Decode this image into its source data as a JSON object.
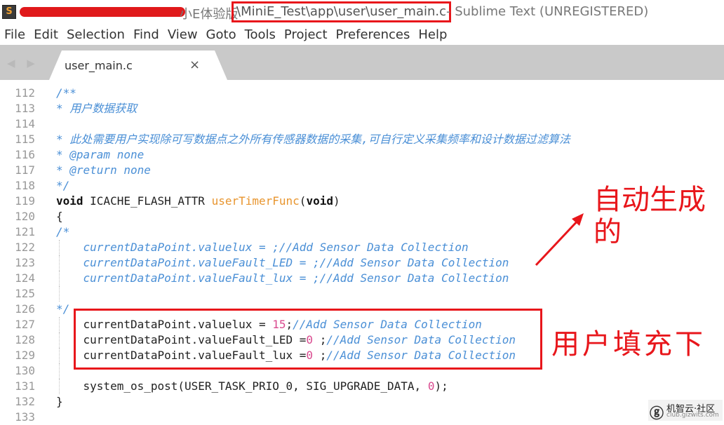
{
  "window": {
    "icon_label": "S",
    "title_path_prefix": "小E体验版",
    "title_path_highlighted": "\\MiniE_Test\\app\\user\\user_main.c",
    "title_suffix": " - Sublime Text (UNREGISTERED)"
  },
  "menu": [
    "File",
    "Edit",
    "Selection",
    "Find",
    "View",
    "Goto",
    "Tools",
    "Project",
    "Preferences",
    "Help"
  ],
  "tabs": {
    "nav_arrows": "◀ ▶",
    "active": {
      "label": "user_main.c",
      "close_icon": "×"
    }
  },
  "editor": {
    "lines": [
      {
        "num": "112",
        "segments": [
          [
            "cm",
            "/**"
          ]
        ]
      },
      {
        "num": "113",
        "segments": [
          [
            "cm",
            "* 用户数据获取"
          ]
        ]
      },
      {
        "num": "114",
        "segments": []
      },
      {
        "num": "115",
        "segments": [
          [
            "cm",
            "* 此处需要用户实现除可写数据点之外所有传感器数据的采集,可自行定义采集频率和设计数据过滤算法"
          ]
        ]
      },
      {
        "num": "116",
        "segments": [
          [
            "cm",
            "* @param none"
          ]
        ]
      },
      {
        "num": "117",
        "segments": [
          [
            "cm",
            "* @return none"
          ]
        ]
      },
      {
        "num": "118",
        "segments": [
          [
            "cm",
            "*/"
          ]
        ]
      },
      {
        "num": "119",
        "segments": [
          [
            "kw",
            "void"
          ],
          [
            "",
            " ICACHE_FLASH_ATTR "
          ],
          [
            "fn",
            "userTimerFunc"
          ],
          [
            "",
            "("
          ],
          [
            "kw",
            "void"
          ],
          [
            "",
            ")"
          ]
        ]
      },
      {
        "num": "120",
        "segments": [
          [
            "",
            "{"
          ]
        ]
      },
      {
        "num": "121",
        "segments": [
          [
            "cm",
            "/*"
          ]
        ]
      },
      {
        "num": "122",
        "segments": [
          [
            "cm",
            "    currentDataPoint.valuelux = ;//Add Sensor Data Collection"
          ]
        ]
      },
      {
        "num": "123",
        "segments": [
          [
            "cm",
            "    currentDataPoint.valueFault_LED = ;//Add Sensor Data Collection"
          ]
        ]
      },
      {
        "num": "124",
        "segments": [
          [
            "cm",
            "    currentDataPoint.valueFault_lux = ;//Add Sensor Data Collection"
          ]
        ]
      },
      {
        "num": "125",
        "segments": []
      },
      {
        "num": "126",
        "segments": [
          [
            "cm",
            "*/"
          ]
        ]
      },
      {
        "num": "127",
        "segments": [
          [
            "",
            "    currentDataPoint.valuelux = "
          ],
          [
            "num",
            "15"
          ],
          [
            "",
            ";"
          ],
          [
            "cm",
            "//Add Sensor Data Collection"
          ]
        ]
      },
      {
        "num": "128",
        "segments": [
          [
            "",
            "    currentDataPoint.valueFault_LED ="
          ],
          [
            "num",
            "0"
          ],
          [
            "",
            " ;"
          ],
          [
            "cm",
            "//Add Sensor Data Collection"
          ]
        ]
      },
      {
        "num": "129",
        "segments": [
          [
            "",
            "    currentDataPoint.valueFault_lux ="
          ],
          [
            "num",
            "0"
          ],
          [
            "",
            " ;"
          ],
          [
            "cm",
            "//Add Sensor Data Collection"
          ]
        ]
      },
      {
        "num": "130",
        "segments": []
      },
      {
        "num": "131",
        "segments": [
          [
            "",
            "    system_os_post(USER_TASK_PRIO_0, SIG_UPGRADE_DATA, "
          ],
          [
            "num",
            "0"
          ],
          [
            "",
            ");"
          ]
        ]
      },
      {
        "num": "132",
        "segments": [
          [
            "",
            "}"
          ]
        ]
      },
      {
        "num": "133",
        "segments": []
      }
    ]
  },
  "annotations": {
    "auto_generated": "自动生成的",
    "user_fill": "用户填充下"
  },
  "watermark": {
    "name": "机智云·社区",
    "url": "club.gizwits.com"
  },
  "colors": {
    "comment": "#4a8fd6",
    "function": "#e8952e",
    "number": "#d94a8f",
    "annotation": "#e8161b"
  }
}
